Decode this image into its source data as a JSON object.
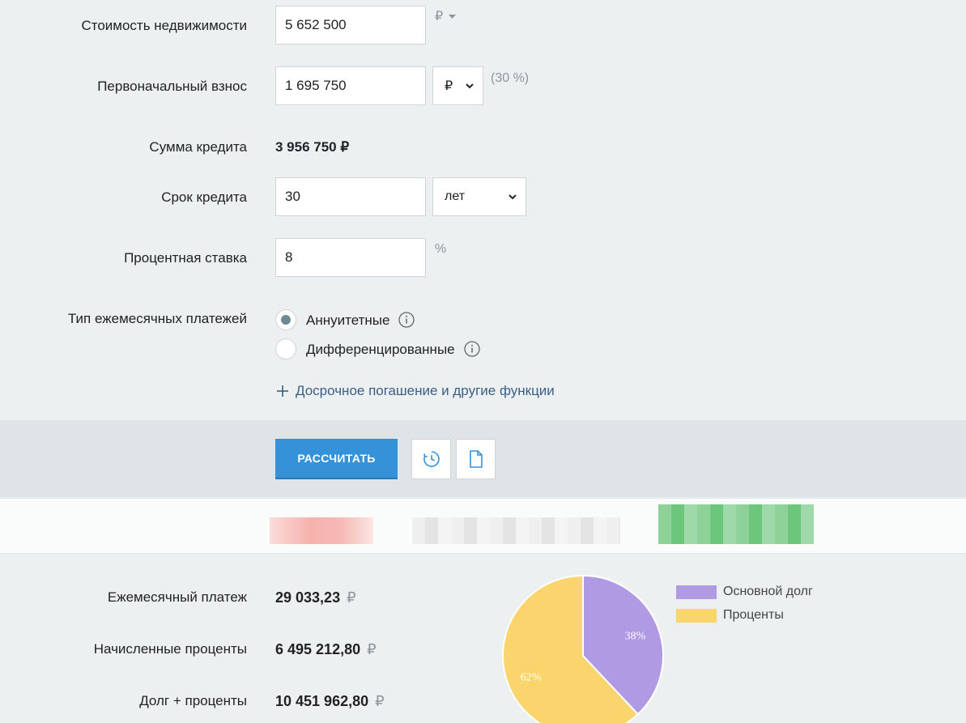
{
  "form": {
    "price": {
      "label": "Стоимость недвижимости",
      "value": "5 652 500",
      "unit": "₽"
    },
    "down_payment": {
      "label": "Первоначальный взнос",
      "value": "1 695 750",
      "unit_select": "₽",
      "percent": "(30 %)"
    },
    "loan_amount": {
      "label": "Сумма кредита",
      "value": "3 956 750 ₽"
    },
    "term": {
      "label": "Срок кредита",
      "value": "30",
      "unit_select": "лет"
    },
    "rate": {
      "label": "Процентная ставка",
      "value": "8",
      "unit": "%"
    },
    "payment_type": {
      "label": "Тип ежемесячных платежей",
      "options": [
        {
          "label": "Аннуитетные",
          "checked": true
        },
        {
          "label": "Дифференцированные",
          "checked": false
        }
      ]
    },
    "more_link": "Досрочное погашение и другие функции"
  },
  "actions": {
    "calculate": "РАССЧИТАТЬ",
    "history_icon": "clock-icon",
    "export_icon": "document-icon"
  },
  "results": {
    "monthly": {
      "label": "Ежемесячный платеж",
      "value": "29 033,23",
      "currency": "₽"
    },
    "interest": {
      "label": "Начисленные проценты",
      "value": "6 495 212,80",
      "currency": "₽"
    },
    "total": {
      "label": "Долг + проценты",
      "value": "10 451 962,80",
      "currency": "₽"
    }
  },
  "chart_data": {
    "type": "pie",
    "slices": [
      {
        "label": "Основной долг",
        "value": 38,
        "display": "38%",
        "color": "#b09ae3"
      },
      {
        "label": "Проценты",
        "value": 62,
        "display": "62%",
        "color": "#fad56e"
      }
    ],
    "legend_position": "right"
  },
  "colors": {
    "accent": "#3592d9",
    "link": "#3b5e86"
  }
}
